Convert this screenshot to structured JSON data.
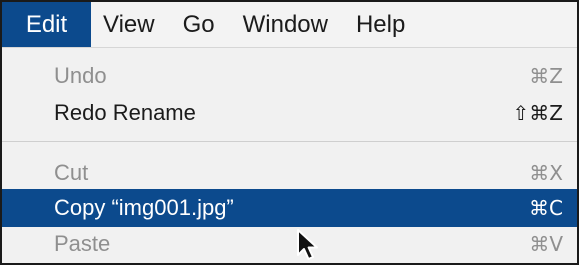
{
  "menubar": {
    "items": [
      {
        "label": "Edit"
      },
      {
        "label": "View"
      },
      {
        "label": "Go"
      },
      {
        "label": "Window"
      },
      {
        "label": "Help"
      }
    ]
  },
  "edit_menu": {
    "undo": {
      "label": "Undo",
      "shortcut": "⌘Z",
      "enabled": false
    },
    "redo": {
      "label": "Redo Rename",
      "shortcut": "⇧⌘Z",
      "enabled": true
    },
    "cut": {
      "label": "Cut",
      "shortcut": "⌘X",
      "enabled": false
    },
    "copy": {
      "label": "Copy “img001.jpg”",
      "shortcut": "⌘C",
      "enabled": true,
      "highlighted": true
    },
    "paste": {
      "label": "Paste",
      "shortcut": "⌘V",
      "enabled": false
    }
  },
  "colors": {
    "highlight": "#0c4a8d",
    "menu_background": "#f1f1f1",
    "disabled_text": "#8f8f8f"
  },
  "icons": {
    "cursor": "arrow-pointer-icon"
  }
}
